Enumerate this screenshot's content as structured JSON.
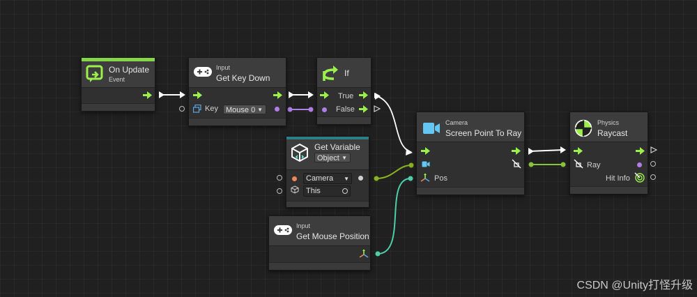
{
  "colors": {
    "background": "#202020",
    "control_flow": "#9cf04c",
    "event_accent": "#86d64a",
    "variable_accent": "#2c7f86",
    "boolean_port": "#b07fe6",
    "object_port": "#8bb220",
    "vector_port": "#4fcfa8",
    "ray_wire": "#8ac33a",
    "flow_wire": "#ffffff"
  },
  "nodes": {
    "on_update": {
      "title": "On Update",
      "subtitle": "Event",
      "icon": "event-loop-icon"
    },
    "get_key_down": {
      "subtitle": "Input",
      "title": "Get Key Down",
      "icon": "gamepad-icon",
      "port_label": "Key",
      "key_value": "Mouse 0",
      "key_icon": "keycode-icon"
    },
    "if_node": {
      "title": "If",
      "icon": "branch-icon",
      "true_label": "True",
      "false_label": "False"
    },
    "get_variable": {
      "title": "Get Variable",
      "kind_value": "Object",
      "icon": "variable-box-icon",
      "name_value": "Camera",
      "target_value": "This",
      "target_icon": "cube-icon"
    },
    "get_mouse_position": {
      "subtitle": "Input",
      "title": "Get Mouse Position",
      "icon": "gamepad-icon",
      "output_icon": "vector3-icon"
    },
    "screen_point_to_ray": {
      "subtitle": "Camera",
      "title": "Screen Point To Ray",
      "icon": "camera-icon",
      "pos_label": "Pos",
      "ray_icon": "ray-icon"
    },
    "raycast": {
      "subtitle": "Physics",
      "title": "Raycast",
      "icon": "physics-ball-icon",
      "ray_label": "Ray",
      "hit_label": "Hit Info",
      "hit_icon": "hit-target-icon"
    }
  },
  "watermark": "CSDN @Unity打怪升级"
}
